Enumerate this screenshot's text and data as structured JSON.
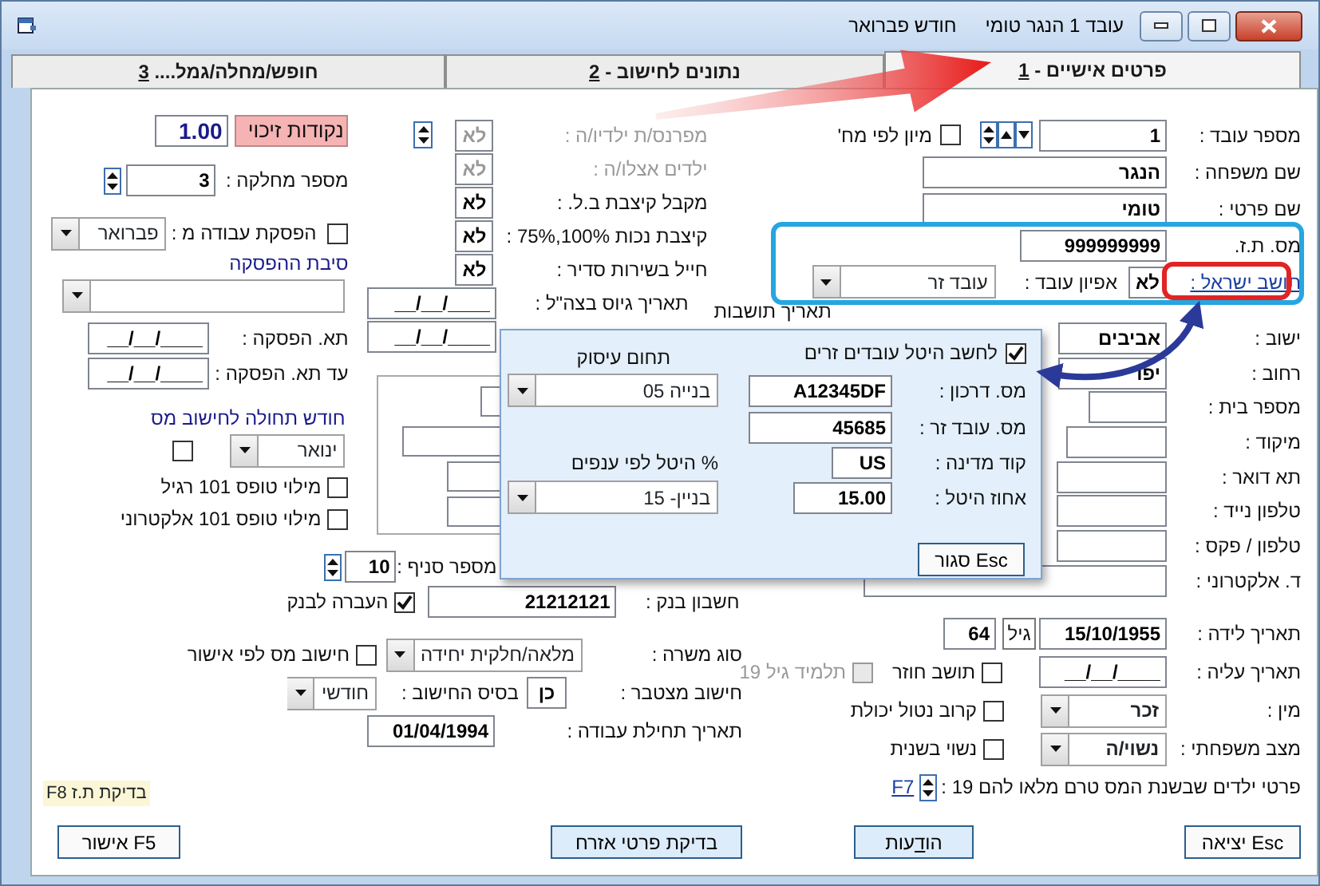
{
  "window": {
    "month": "חודש פברואר",
    "employee": "עובד 1 הנגר טומי"
  },
  "tabs": [
    {
      "label": "פרטים אישיים - ",
      "key": "1",
      "selected": true
    },
    {
      "label": "נתונים לחישוב - ",
      "key": "2",
      "selected": false
    },
    {
      "label": "חופש/מחלה/גמל.... ",
      "key": "3",
      "selected": false
    }
  ],
  "personal": {
    "employee_no": {
      "label": "מספר עובד :",
      "value": "1"
    },
    "sort_by_department": {
      "label": "מיון לפי מח'",
      "checked": false
    },
    "last_name": {
      "label": "שם משפחה :",
      "value": "הנגר"
    },
    "first_name": {
      "label": "שם פרטי :",
      "value": "טומי"
    },
    "id_no": {
      "label": "מס. ת.ז.",
      "value": "999999999"
    },
    "israeli_resident": {
      "label": "תושב ישראל :",
      "value": "לא"
    },
    "employee_type": {
      "label": "אפיון עובד :",
      "value": "עובד זר"
    },
    "residency_date": {
      "label": "תאריך תושבות"
    },
    "contact": [
      {
        "label": "ישוב :",
        "value": "אביבים"
      },
      {
        "label": "רחוב :",
        "value": "יפו"
      },
      {
        "label": "מספר בית :"
      },
      {
        "label": "מיקוד :"
      },
      {
        "label": "תא דואר :"
      },
      {
        "label": "טלפון נייד :"
      },
      {
        "label": "טלפון / פקס :"
      },
      {
        "label": "ד. אלקטרוני :"
      }
    ],
    "birth_date": {
      "label": "תאריך לידה :",
      "value": "15/10/1955"
    },
    "age": {
      "label": "גיל",
      "value": "64"
    },
    "aliya_date": {
      "label": "תאריך עליה :",
      "value": "__/__/____"
    },
    "gender": {
      "label": "מין :",
      "value": "זכר"
    },
    "marital_status": {
      "label": "מצב משפחתי :",
      "value": "נשוי/ה"
    },
    "options": [
      {
        "label": "תושב חוזר",
        "checked": false,
        "disabled": false
      },
      {
        "label": "תלמיד גיל 19",
        "checked": false,
        "disabled": true
      },
      {
        "label": "קרוב נטול יכולת",
        "checked": false,
        "disabled": false
      },
      {
        "label": "נשוי בשנית",
        "checked": false,
        "disabled": false
      }
    ],
    "children": {
      "label": "פרטי ילדים שבשנת המס טרם מלאו להם 19 :",
      "link": "F7"
    }
  },
  "tax": {
    "flags": [
      {
        "label": "מפרנס/ת ילדיו/ה :",
        "value": "לא",
        "disabled": true
      },
      {
        "label": "ילדים אצלו/ה :",
        "value": "לא",
        "disabled": true
      },
      {
        "label": "מקבל קיצבת ב.ל. :",
        "value": "לא",
        "disabled": false
      },
      {
        "label": "קיצבת נכות 100%,75% :",
        "value": "לא",
        "disabled": false
      },
      {
        "label": "חייל בשירות סדיר :",
        "value": "לא",
        "disabled": false
      }
    ],
    "enlist_date": {
      "label": "תאריך גיוס בצה\"ל :",
      "value": "__/__/____"
    },
    "date_field": {
      "value": "__/__/____"
    },
    "branch": {
      "label": "מספר סניף :",
      "value": "10"
    },
    "bank_account": {
      "label": "חשבון בנק :",
      "value": "21212121"
    },
    "bank_transfer": {
      "label": "העברה לבנק",
      "checked": true
    },
    "job_type": {
      "label": "סוג משרה :",
      "value": "מלאה/חלקית יחידה"
    },
    "tax_by_approval": {
      "label": "חישוב מס לפי אישור",
      "checked": false
    },
    "cumulative": {
      "label": "חישוב מצטבר :",
      "value": "כן"
    },
    "calc_basis": {
      "label": "בסיס החישוב :",
      "value": "חודשי"
    },
    "start_date": {
      "label": "תאריך תחילת עבודה :",
      "value": "01/04/1994"
    }
  },
  "work": {
    "credit_points": {
      "label": "נקודות זיכוי",
      "value": "1.00"
    },
    "department": {
      "label": "מספר מחלקה :",
      "value": "3"
    },
    "stop_work": {
      "label": "הפסקת עבודה מ :",
      "checked": false,
      "value": "פברואר"
    },
    "stop_reason": {
      "label": "סיבת ההפסקה"
    },
    "stop_date": {
      "label": "תא. הפסקה :",
      "value": "__/__/____"
    },
    "stop_until": {
      "label": "עד תא. הפסקה :",
      "value": "__/__/____"
    },
    "tax_start_month": {
      "label": "חודש תחולה לחישוב מס",
      "value": "ינואר",
      "checked": false
    },
    "form_101": [
      {
        "label": "מילוי טופס 101 רגיל",
        "checked": false
      },
      {
        "label": "מילוי טופס 101 אלקטרוני",
        "checked": false
      }
    ]
  },
  "foreign_worker_dialog": {
    "levy": {
      "label": "לחשב היטל עובדים זרים",
      "checked": true
    },
    "occupation": {
      "label": "תחום עיסוק",
      "value": "05 בנייה"
    },
    "passport": {
      "label": "מס. דרכון :",
      "value": "A12345DF"
    },
    "worker_no": {
      "label": "מס. עובד זר :",
      "value": "45685"
    },
    "country": {
      "label": "קוד מדינה :",
      "value": "US"
    },
    "levy_by_branch": {
      "label": "% היטל לפי ענפים",
      "value": "15 -בניין"
    },
    "levy_percent": {
      "label": "אחוז היטל :",
      "value": "15.00"
    },
    "close_button": "סגור Esc"
  },
  "id_check_hint": "F8 בדיקת ת.ז",
  "buttons": {
    "exit": "יציאה Esc",
    "messages": {
      "start": "הו",
      "hotkey": "ד",
      "end": "עות"
    },
    "citizen_check": "בדיקת פרטי אזרח",
    "approve": "אישור F5"
  }
}
